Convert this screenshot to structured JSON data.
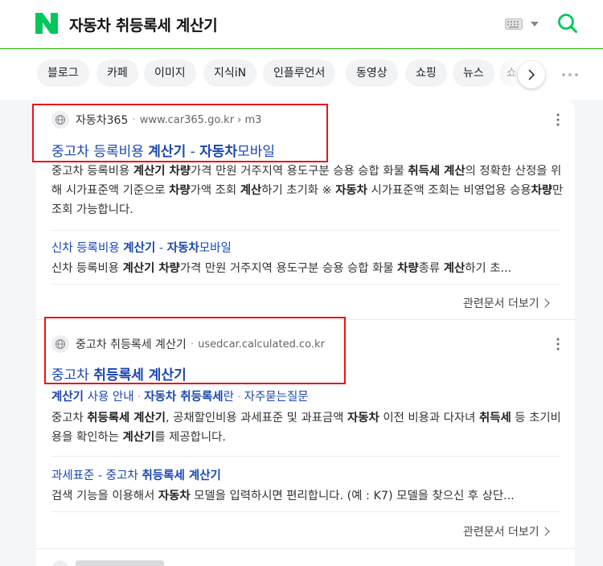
{
  "header": {
    "query": "자동차 취등록세 계산기"
  },
  "tabs": [
    {
      "label": "블로그"
    },
    {
      "label": "카페"
    },
    {
      "label": "이미지"
    },
    {
      "label": "지식iN"
    },
    {
      "label": "인플루언서"
    },
    {
      "label": "동영상"
    },
    {
      "label": "쇼핑"
    },
    {
      "label": "뉴스"
    },
    {
      "label": "쇼"
    }
  ],
  "results": [
    {
      "source_name": "자동차365",
      "source_url": "www.car365.go.kr › m3",
      "title_parts": [
        "중고차 등록비용 ",
        "계산기",
        " - ",
        "자동차",
        "모바일"
      ],
      "desc_parts": [
        "중고차 등록비용 ",
        "계산기 차량",
        "가격 만원 거주지역 용도구분 승용 승합 화물 ",
        "취득세 계산",
        "의 정확한 산정을 위해 시가표준액 기준으로 ",
        "차량",
        "가액 조회 ",
        "계산",
        "하기 초기화 ※ ",
        "자동차",
        " 시가표준액 조회는 비영업용 승용",
        "차량",
        "만 조회 가능합니다."
      ],
      "sub_title_parts": [
        "신차 등록비용 ",
        "계산기",
        " - ",
        "자동차",
        "모바일"
      ],
      "sub_desc_parts": [
        "신차 등록비용 ",
        "계산기 차량",
        "가격 만원 거주지역 용도구분 승용 승합 화물 ",
        "차량",
        "종류 ",
        "계산",
        "하기 초..."
      ],
      "related": "관련문서 더보기"
    },
    {
      "source_name": "중고차 취등록세 계산기",
      "source_url": "usedcar.calculated.co.kr",
      "title_parts": [
        "중고차 ",
        "취등록세 계산기"
      ],
      "sitelinks": [
        {
          "bold": "계산기",
          "rest": " 사용 안내"
        },
        {
          "bold": "자동차 취등록세",
          "rest": "란"
        },
        {
          "bold": "",
          "rest": "자주묻는질문"
        }
      ],
      "desc_parts": [
        "중고차 ",
        "취등록세 계산기",
        ", 공채할인비용 과세표준 및 과표금액 ",
        "자동차",
        " 이전 비용과 다자녀 ",
        "취득세",
        " 등 초기비용을 확인하는 ",
        "계산기",
        "를 제공합니다."
      ],
      "sub_title_parts": [
        "과세표준 - 중고차 ",
        "취등록세 계산기"
      ],
      "sub_desc_parts": [
        "검색 기능을 이용해서 ",
        "자동차",
        " 모델을 입력하시면 편리합니다. (예 : K7) 모델을 찾으신 후 상단..."
      ],
      "related": "관련문서 더보기"
    }
  ],
  "colors": {
    "brand_green": "#03c75a",
    "link_blue": "#1a46b3",
    "highlight_red": "#e8141a"
  }
}
